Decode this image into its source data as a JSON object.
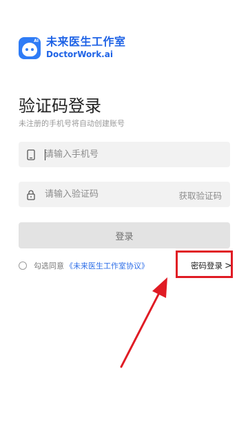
{
  "brand": {
    "name_cn": "未来医生工作室",
    "name_en": "DoctorWork.ai",
    "logo_badge": "AI"
  },
  "login": {
    "title": "验证码登录",
    "subtitle": "未注册的手机号将自动创建账号",
    "phone_placeholder": "请输入手机号",
    "code_placeholder": "请输入验证码",
    "get_code_label": "获取验证码",
    "submit_label": "登录"
  },
  "agreement": {
    "prefix": "勾选同意",
    "link": "《未来医生工作室协议》",
    "checked": false
  },
  "switch": {
    "password_login_label": "密码登录",
    "chevron": ">"
  },
  "colors": {
    "brand": "#2f7cf6",
    "link": "#2f6fe8",
    "annotation": "#e01b24",
    "button_disabled": "#e3e3e3"
  },
  "icons": {
    "phone": "phone-icon",
    "lock": "lock-icon",
    "logo": "doctor-face-logo-icon"
  }
}
